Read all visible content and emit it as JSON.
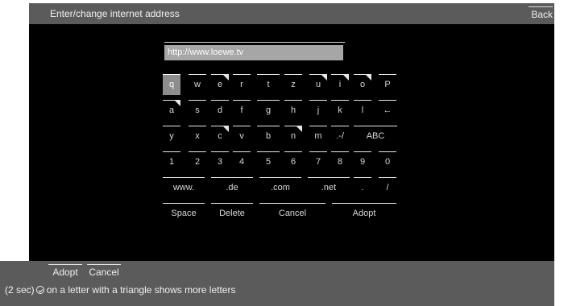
{
  "window": {
    "title": "Enter/change internet address",
    "back_label": "Back"
  },
  "address": {
    "value": "http://www.loewe.tv"
  },
  "keyboard": {
    "rows": [
      {
        "keys": [
          {
            "label": "q",
            "selected": true,
            "triangle": false
          },
          {
            "label": "w",
            "selected": false,
            "triangle": false
          },
          {
            "label": "e",
            "selected": false,
            "triangle": true
          },
          {
            "label": "r",
            "selected": false,
            "triangle": false
          },
          {
            "label": "t",
            "selected": false,
            "triangle": false
          },
          {
            "label": "z",
            "selected": false,
            "triangle": false
          },
          {
            "label": "u",
            "selected": false,
            "triangle": true
          },
          {
            "label": "i",
            "selected": false,
            "triangle": true
          },
          {
            "label": "o",
            "selected": false,
            "triangle": true
          },
          {
            "label": "P",
            "selected": false,
            "triangle": false
          }
        ]
      },
      {
        "keys": [
          {
            "label": "a",
            "selected": false,
            "triangle": true
          },
          {
            "label": "s",
            "selected": false,
            "triangle": false
          },
          {
            "label": "d",
            "selected": false,
            "triangle": false
          },
          {
            "label": "f",
            "selected": false,
            "triangle": false
          },
          {
            "label": "g",
            "selected": false,
            "triangle": false
          },
          {
            "label": "h",
            "selected": false,
            "triangle": false
          },
          {
            "label": "j",
            "selected": false,
            "triangle": false
          },
          {
            "label": "k",
            "selected": false,
            "triangle": false
          },
          {
            "label": "l",
            "selected": false,
            "triangle": false
          },
          {
            "label": "←",
            "selected": false,
            "triangle": false
          }
        ]
      },
      {
        "keys": [
          {
            "label": "y",
            "selected": false,
            "triangle": false
          },
          {
            "label": "x",
            "selected": false,
            "triangle": false
          },
          {
            "label": "c",
            "selected": false,
            "triangle": true
          },
          {
            "label": "v",
            "selected": false,
            "triangle": false
          },
          {
            "label": "b",
            "selected": false,
            "triangle": false
          },
          {
            "label": "n",
            "selected": false,
            "triangle": true
          },
          {
            "label": "m",
            "selected": false,
            "triangle": false
          },
          {
            "label": ".-/",
            "selected": false,
            "triangle": false
          },
          {
            "label": "ABC",
            "selected": false,
            "triangle": false
          }
        ]
      },
      {
        "keys": [
          {
            "label": "1",
            "selected": false,
            "triangle": false
          },
          {
            "label": "2",
            "selected": false,
            "triangle": false
          },
          {
            "label": "3",
            "selected": false,
            "triangle": false
          },
          {
            "label": "4",
            "selected": false,
            "triangle": false
          },
          {
            "label": "5",
            "selected": false,
            "triangle": false
          },
          {
            "label": "6",
            "selected": false,
            "triangle": false
          },
          {
            "label": "7",
            "selected": false,
            "triangle": false
          },
          {
            "label": "8",
            "selected": false,
            "triangle": false
          },
          {
            "label": "9",
            "selected": false,
            "triangle": false
          },
          {
            "label": "0",
            "selected": false,
            "triangle": false
          }
        ]
      },
      {
        "keys": [
          {
            "label": "www.",
            "selected": false,
            "triangle": false
          },
          {
            "label": ".de",
            "selected": false,
            "triangle": false
          },
          {
            "label": ".com",
            "selected": false,
            "triangle": false
          },
          {
            "label": ".net",
            "selected": false,
            "triangle": false
          },
          {
            "label": ".",
            "selected": false,
            "triangle": false
          },
          {
            "label": "/",
            "selected": false,
            "triangle": false
          }
        ]
      },
      {
        "keys": [
          {
            "label": "Space",
            "selected": false,
            "triangle": false
          },
          {
            "label": "Delete",
            "selected": false,
            "triangle": false
          },
          {
            "label": "Cancel",
            "selected": false,
            "triangle": false
          },
          {
            "label": "Adopt",
            "selected": false,
            "triangle": false
          }
        ]
      }
    ]
  },
  "footer": {
    "adopt_label": "Adopt",
    "cancel_label": "Cancel",
    "hint_prefix": "(2 sec)",
    "hint_icon": "ok-circle-icon",
    "hint_suffix": " on a letter with a triangle shows more letters"
  },
  "colors": {
    "title_bar": "#5b5b5b",
    "panel": "#000000",
    "selected_key": "#8d8d8d",
    "address_field": "#a6a6a6",
    "text": "#d8d8d8"
  }
}
